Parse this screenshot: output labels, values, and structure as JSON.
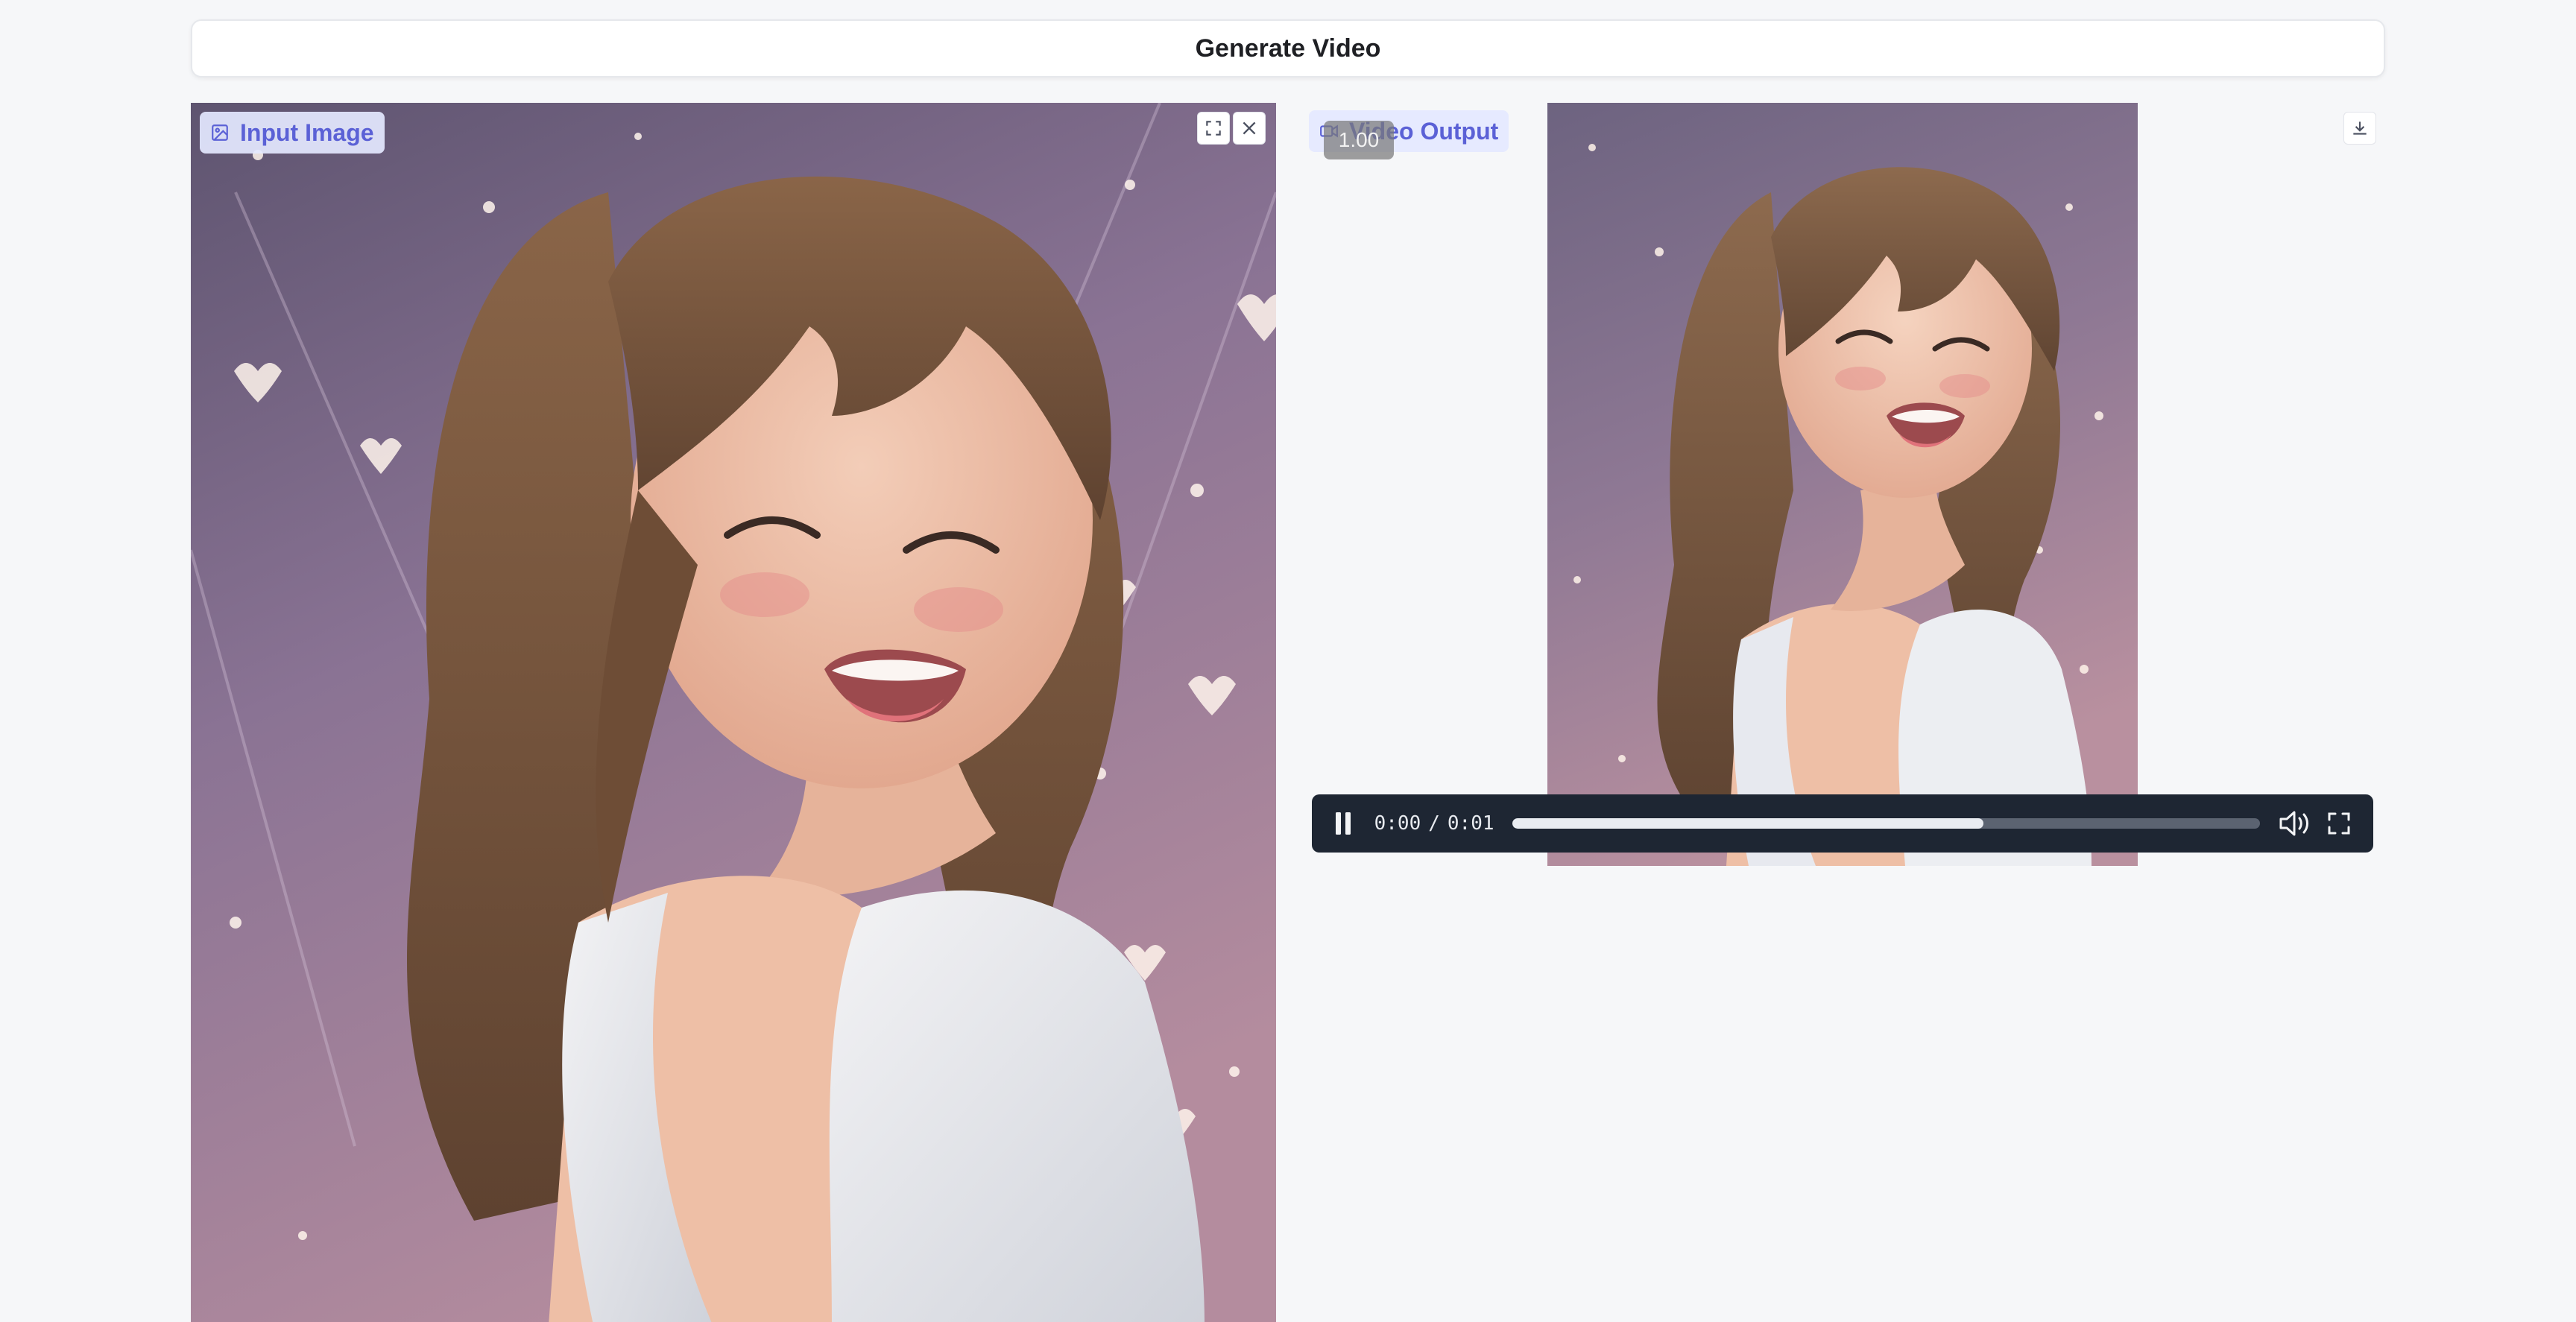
{
  "generate_button": {
    "label": "Generate Video"
  },
  "input_panel": {
    "badge_label": "Input Image",
    "badge_icon": "image-icon",
    "fullscreen_icon": "fullscreen-icon",
    "close_icon": "close-icon"
  },
  "output_panel": {
    "badge_label": "Video Output",
    "badge_icon": "video-camera-icon",
    "download_icon": "download-icon",
    "playback_rate": "1.00",
    "player": {
      "current_time": "0:00",
      "separator": "/",
      "duration": "0:01",
      "progress": 0.63,
      "play_icon": "pause-icon",
      "volume_icon": "volume-icon",
      "fullscreen_icon": "fullscreen-icon"
    }
  },
  "colors": {
    "accent": "#5b61d6",
    "badge_bg": "#e4e8ff",
    "player_bg": "#1e2633",
    "page_bg": "#f6f7f9"
  }
}
